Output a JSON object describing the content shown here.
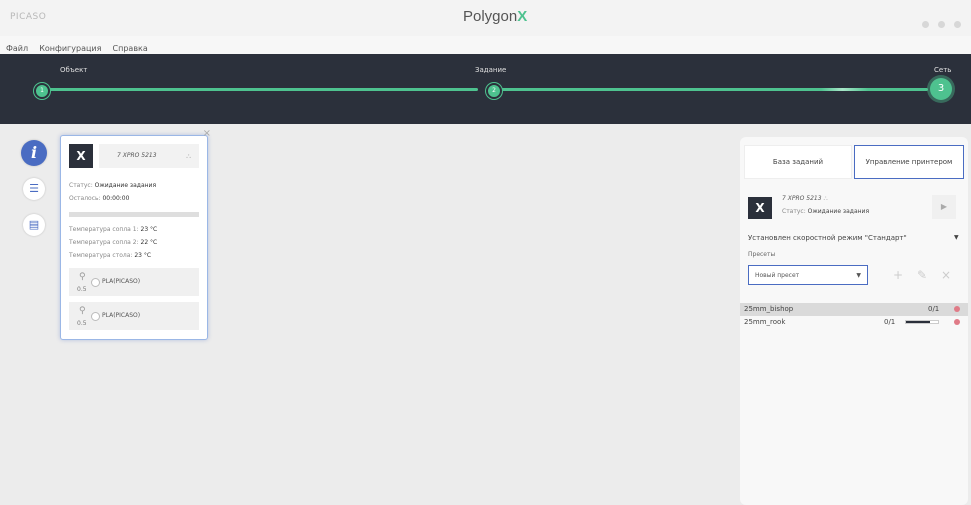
{
  "app": {
    "brand": "PICASO",
    "logo_text": "Polygon",
    "logo_mark": "X"
  },
  "menu": [
    "Файл",
    "Конфигурация",
    "Справка"
  ],
  "wizard": {
    "steps": [
      {
        "label": "Объект",
        "num": "1"
      },
      {
        "label": "Задание",
        "num": "2"
      },
      {
        "label": "Сеть",
        "num": "3"
      }
    ],
    "accent": "#4ec28f"
  },
  "sidebar": {
    "icons": [
      "info-icon",
      "list-icon",
      "folder-icon"
    ],
    "info_glyph": "i",
    "list_glyph": "☰",
    "folder_glyph": "▤"
  },
  "printer_card": {
    "model": "7 XPRO 5213",
    "logo_glyph": "X",
    "share_glyph": "⛬",
    "status_label": "Статус:",
    "status_value": "Ожидание задания",
    "remaining_label": "Осталось:",
    "remaining_value": "00:00:00",
    "progress": 0,
    "temp1_label": "Температура сопла 1:",
    "temp1_value": "23 °C",
    "temp2_label": "Температура сопла 2:",
    "temp2_value": "22 °C",
    "bed_label": "Температура стола:",
    "bed_value": "23 °C",
    "spools": [
      {
        "diameter": "0.5",
        "material": "PLA(PICASO)"
      },
      {
        "diameter": "0.5",
        "material": "PLA(PICASO)"
      }
    ],
    "close_glyph": "×"
  },
  "right_panel": {
    "tab_db": "База заданий",
    "tab_control": "Управление принтером",
    "printer_model": "7 XPRO 5213",
    "status_label": "Статус:",
    "status_value": "Ожидание задания",
    "play_glyph": "▶",
    "speed_mode": "Установлен скоростной режим \"Стандарт\"",
    "speed_caret": "▼",
    "presets_label": "Пресеты",
    "preset_value": "Новый пресет",
    "preset_caret": "▼",
    "add_glyph": "+",
    "edit_glyph": "✎",
    "remove_glyph": "×",
    "queue": [
      {
        "name": "25mm_bishop",
        "count": "0/1",
        "progress": null
      },
      {
        "name": "25mm_rook",
        "count": "0/1",
        "progress": 0.75
      }
    ]
  }
}
